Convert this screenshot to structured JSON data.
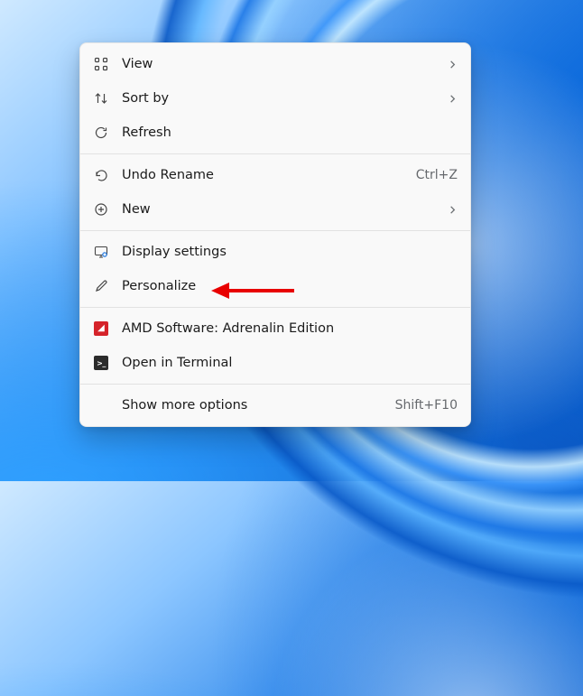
{
  "menu": {
    "view": {
      "label": "View"
    },
    "sort": {
      "label": "Sort by"
    },
    "refresh": {
      "label": "Refresh"
    },
    "undo": {
      "label": "Undo Rename",
      "shortcut": "Ctrl+Z"
    },
    "new": {
      "label": "New"
    },
    "display": {
      "label": "Display settings"
    },
    "personalize": {
      "label": "Personalize"
    },
    "amd": {
      "label": "AMD Software: Adrenalin Edition"
    },
    "terminal": {
      "label": "Open in Terminal"
    },
    "more": {
      "label": "Show more options",
      "shortcut": "Shift+F10"
    }
  }
}
